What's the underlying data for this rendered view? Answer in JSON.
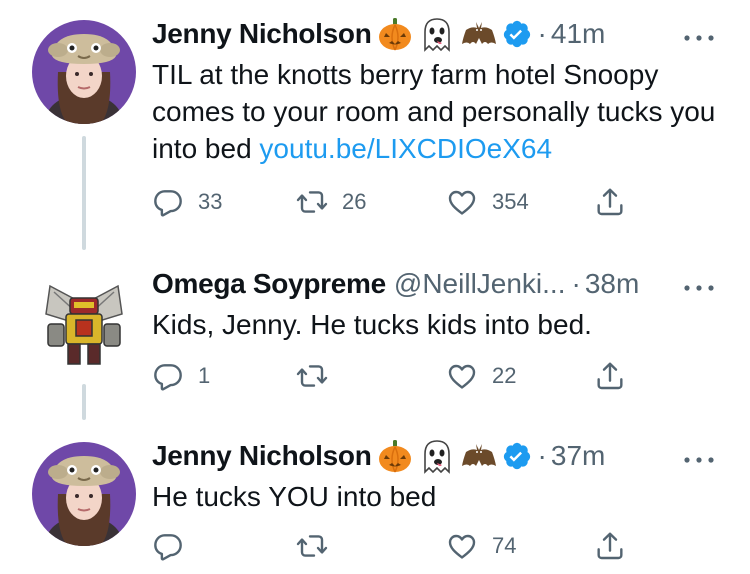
{
  "tweets": [
    {
      "name": "Jenny Nicholson",
      "handle": "",
      "emoji_icons": [
        "pumpkin-icon",
        "ghost-icon",
        "bat-icon"
      ],
      "verified": true,
      "time": "41m",
      "text": "TIL at the knotts berry farm hotel Snoopy comes to your room and personally tucks you into bed ",
      "link": "youtu.be/LIXCDIOeX64",
      "replies": "33",
      "retweets": "26",
      "likes": "354"
    },
    {
      "name": "Omega Soypreme",
      "handle": "@NeillJenki...",
      "verified": false,
      "time": "38m",
      "text": "Kids, Jenny. He tucks kids into bed.",
      "replies": "1",
      "retweets": "",
      "likes": "22"
    },
    {
      "name": "Jenny Nicholson",
      "handle": "",
      "emoji_icons": [
        "pumpkin-icon",
        "ghost-icon",
        "bat-icon"
      ],
      "verified": true,
      "time": "37m",
      "text": "He tucks YOU into bed",
      "replies": "",
      "retweets": "",
      "likes": "74"
    }
  ],
  "separator": "·",
  "colors": {
    "text": "#0f1419",
    "secondary": "#536471",
    "link": "#1d9bf0",
    "verified": "#1d9bf0",
    "thread_line": "#cfd9de",
    "avatar_bg_jenny": "#6f48a8"
  }
}
